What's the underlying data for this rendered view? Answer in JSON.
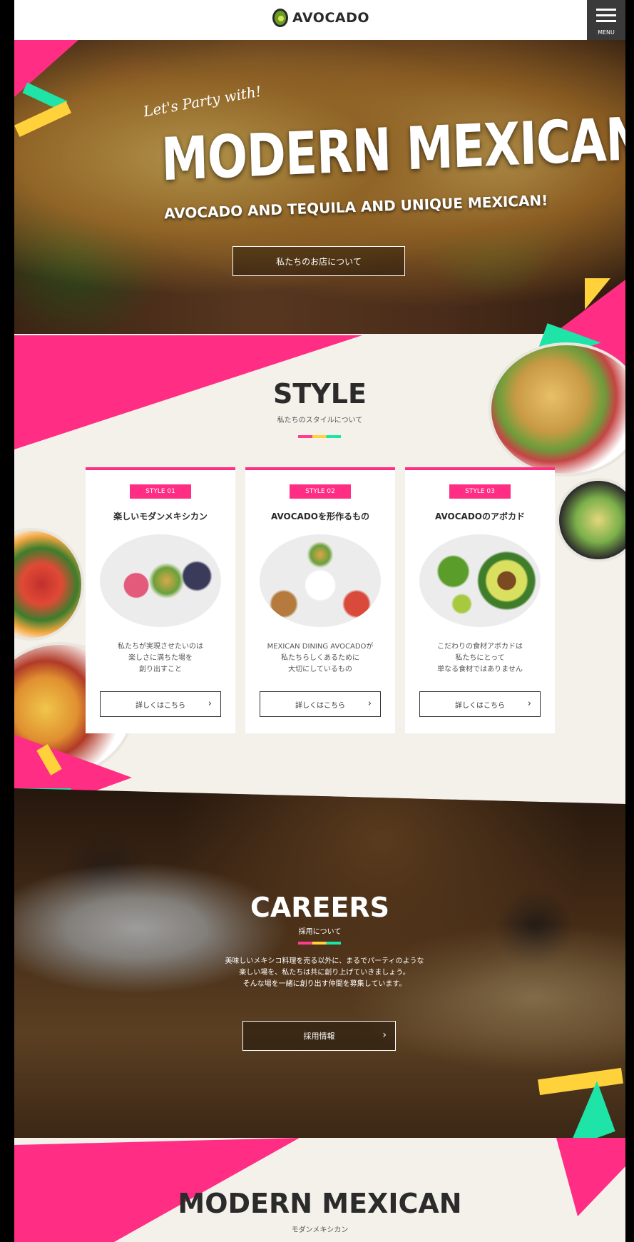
{
  "header": {
    "logo_text": "AVOCADO",
    "menu_label": "MENU"
  },
  "hero": {
    "script_text": "Let's Party with!",
    "title": "MODERN MEXICAN",
    "subtitle": "AVOCADO AND TEQUILA AND UNIQUE MEXICAN!",
    "button_label": "私たちのお店について"
  },
  "style_section": {
    "title": "STYLE",
    "subtitle": "私たちのスタイルについて",
    "cards": [
      {
        "badge": "STYLE 01",
        "title": "楽しいモダンメキシカン",
        "description": "私たちが実現させたいのは\n楽しさに満ちた場を\n創り出すこと",
        "button": "詳しくはこちら"
      },
      {
        "badge": "STYLE 02",
        "title": "AVOCADOを形作るもの",
        "description": "MEXICAN DINING AVOCADOが\n私たちらしくあるために\n大切にしているもの",
        "button": "詳しくはこちら"
      },
      {
        "badge": "STYLE 03",
        "title": "AVOCADOのアボカド",
        "description": "こだわりの食材アボカドは\n私たちにとって\n単なる食材ではありません",
        "button": "詳しくはこちら"
      }
    ]
  },
  "careers": {
    "title": "CAREERS",
    "subtitle": "採用について",
    "text": "美味しいメキシコ料理を売る以外に、まるでパーティのような\n楽しい場を、私たちは共に創り上げていきましょう。\nそんな場を一緒に創り出す仲間を募集しています。",
    "button_label": "採用情報"
  },
  "bottom": {
    "title": "MODERN MEXICAN",
    "subtitle": "モダンメキシカン"
  },
  "colors": {
    "pink": "#ff2d83",
    "mint": "#1ee4a8",
    "yellow": "#ffd23c",
    "dark": "#2b2b2b",
    "cream": "#f4f1eb"
  }
}
